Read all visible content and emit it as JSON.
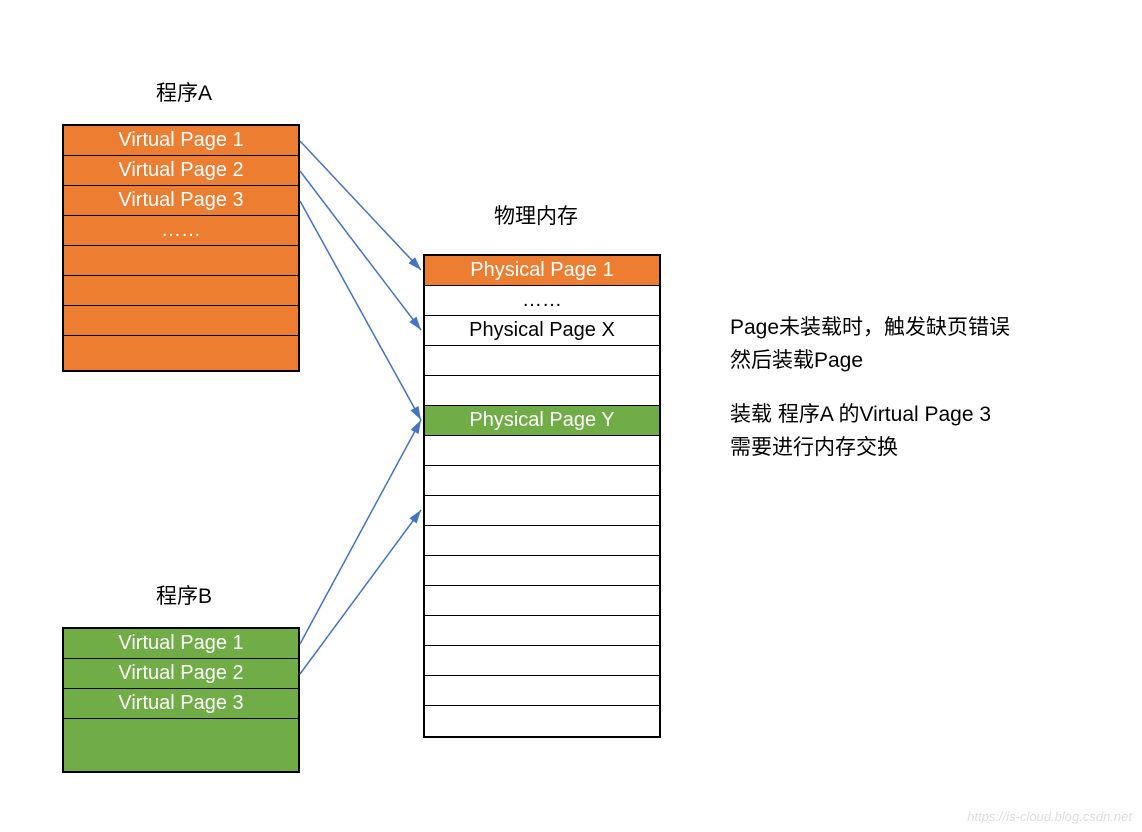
{
  "programA": {
    "title": "程序A",
    "rows": [
      "Virtual Page 1",
      "Virtual Page 2",
      "Virtual Page 3",
      "……",
      "",
      "",
      "",
      ""
    ]
  },
  "programB": {
    "title": "程序B",
    "rows": [
      "Virtual Page 1",
      "Virtual Page 2",
      "Virtual Page 3",
      ""
    ]
  },
  "physical": {
    "title": "物理内存",
    "rows": [
      {
        "label": "Physical Page 1",
        "cls": "orange"
      },
      {
        "label": "……",
        "cls": "white"
      },
      {
        "label": "Physical Page X",
        "cls": "white"
      },
      {
        "label": "",
        "cls": "white"
      },
      {
        "label": "",
        "cls": "white"
      },
      {
        "label": "Physical Page Y",
        "cls": "green"
      },
      {
        "label": "",
        "cls": "white"
      },
      {
        "label": "",
        "cls": "white"
      },
      {
        "label": "",
        "cls": "white"
      },
      {
        "label": "",
        "cls": "white"
      },
      {
        "label": "",
        "cls": "white"
      },
      {
        "label": "",
        "cls": "white"
      },
      {
        "label": "",
        "cls": "white"
      },
      {
        "label": "",
        "cls": "white"
      },
      {
        "label": "",
        "cls": "white"
      },
      {
        "label": "",
        "cls": "white"
      }
    ]
  },
  "annotation": {
    "line1": "Page未装载时，触发缺页错误",
    "line2": "然后装载Page",
    "line3": "装载 程序A 的Virtual Page 3",
    "line4": "需要进行内存交换"
  },
  "watermark": "https://is-cloud.blog.csdn.net"
}
